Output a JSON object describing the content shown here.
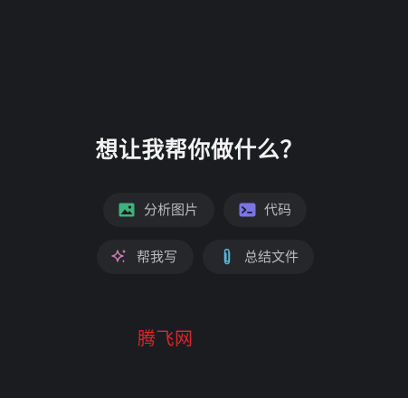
{
  "main": {
    "headline": "想让我帮你做什么？",
    "suggestions": [
      {
        "label": "分析图片",
        "icon": "image-icon",
        "color": "#3fb27f"
      },
      {
        "label": "代码",
        "icon": "code-terminal-icon",
        "color": "#7b74e6"
      },
      {
        "label": "帮我写",
        "icon": "sparkle-icon",
        "color": "#d07fb4"
      },
      {
        "label": "总结文件",
        "icon": "paperclip-icon",
        "color": "#56b7d6"
      }
    ]
  },
  "watermark": {
    "text": "腾飞网",
    "color": "#d9262c"
  },
  "theme": {
    "background": "#1b1c1f",
    "pill_background": "#26272b",
    "text": "#f2f2f3",
    "muted_text": "#b9babe"
  }
}
